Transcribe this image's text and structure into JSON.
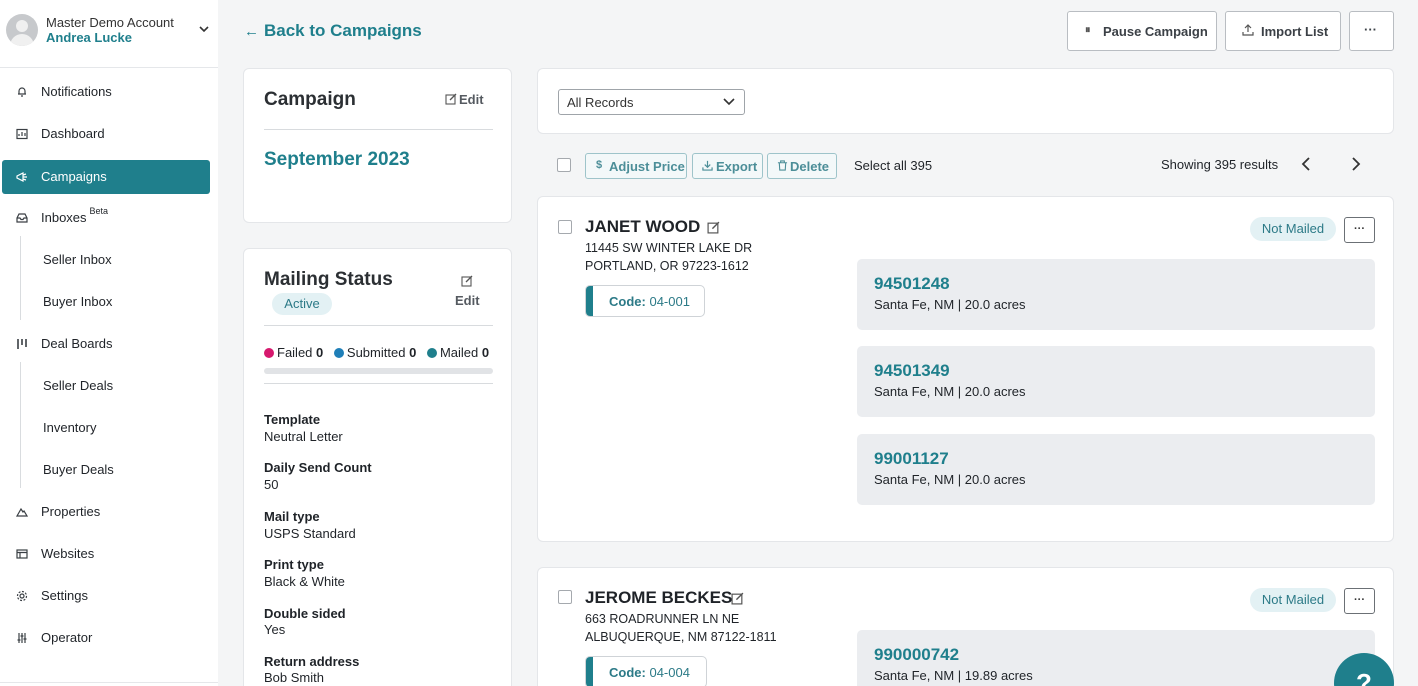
{
  "account": {
    "name": "Master Demo Account",
    "user": "Andrea Lucke"
  },
  "nav": {
    "notifications": "Notifications",
    "dashboard": "Dashboard",
    "campaigns": "Campaigns",
    "inboxes": "Inboxes",
    "inboxes_badge": "Beta",
    "seller_inbox": "Seller Inbox",
    "buyer_inbox": "Buyer Inbox",
    "deal_boards": "Deal Boards",
    "seller_deals": "Seller Deals",
    "inventory": "Inventory",
    "buyer_deals": "Buyer Deals",
    "properties": "Properties",
    "websites": "Websites",
    "settings": "Settings",
    "operator": "Operator"
  },
  "header": {
    "back_label": "Back to Campaigns",
    "pause_label": "Pause Campaign",
    "import_label": "Import List",
    "more_label": "···"
  },
  "campaign_card": {
    "title": "Campaign",
    "edit_label": "Edit",
    "name": "September 2023"
  },
  "mailing_status": {
    "title": "Mailing Status",
    "edit_label": "Edit",
    "status": "Active",
    "failed_label": "Failed",
    "failed_count": "0",
    "submitted_label": "Submitted",
    "submitted_count": "0",
    "mailed_label": "Mailed",
    "mailed_count": "0",
    "progress": 0,
    "details": [
      {
        "label": "Template",
        "value": "Neutral Letter"
      },
      {
        "label": "Daily Send Count",
        "value": "50"
      },
      {
        "label": "Mail type",
        "value": "USPS Standard"
      },
      {
        "label": "Print type",
        "value": "Black & White"
      },
      {
        "label": "Double sided",
        "value": "Yes"
      },
      {
        "label": "Return address",
        "value": "Bob Smith"
      }
    ]
  },
  "filter": {
    "selected": "All Records"
  },
  "actions": {
    "adjust_price": "Adjust Price",
    "export": "Export",
    "delete": "Delete",
    "select_all": "Select all 395",
    "results": "Showing 395 results"
  },
  "records": [
    {
      "name": "JANET WOOD",
      "address_line1": "11445 SW WINTER LAKE DR",
      "address_line2": "PORTLAND, OR 97223-1612",
      "code_label": "Code:",
      "code": "04-001",
      "status": "Not Mailed",
      "parcels": [
        {
          "id": "94501248",
          "info": "Santa Fe, NM | 20.0 acres"
        },
        {
          "id": "94501349",
          "info": "Santa Fe, NM | 20.0 acres"
        },
        {
          "id": "99001127",
          "info": "Santa Fe, NM | 20.0 acres"
        }
      ]
    },
    {
      "name": "JEROME BECKES",
      "address_line1": "663 ROADRUNNER LN NE",
      "address_line2": "ALBUQUERQUE, NM 87122-1811",
      "code_label": "Code:",
      "code": "04-004",
      "status": "Not Mailed",
      "parcels": [
        {
          "id": "990000742",
          "info": "Santa Fe, NM | 19.89 acres"
        }
      ]
    }
  ],
  "help": {
    "label": "?"
  },
  "colors": {
    "accent": "#1f7f8c",
    "failed": "#d6196e",
    "submitted": "#1f7fb8",
    "mailed": "#1f7f8c"
  }
}
